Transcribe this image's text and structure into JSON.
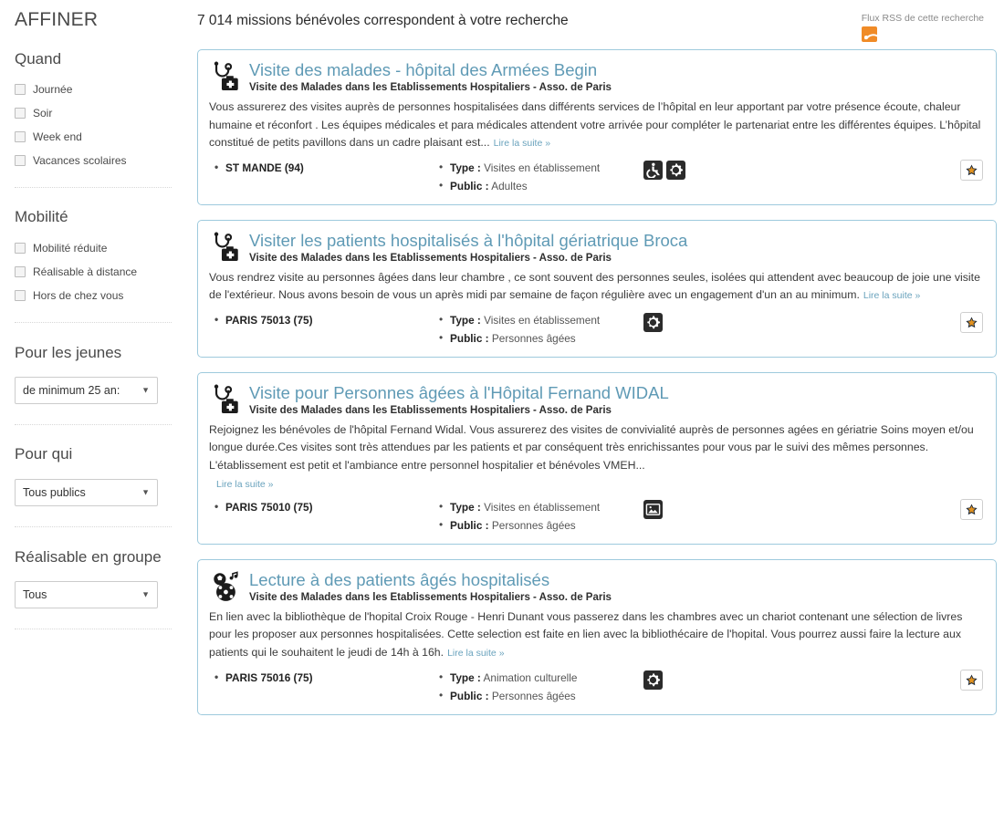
{
  "sidebar": {
    "title": "AFFINER",
    "facets": [
      {
        "heading": "Quand",
        "type": "checkboxes",
        "options": [
          "Journée",
          "Soir",
          "Week end",
          "Vacances scolaires"
        ]
      },
      {
        "heading": "Mobilité",
        "type": "checkboxes",
        "options": [
          "Mobilité réduite",
          "Réalisable à distance",
          "Hors de chez vous"
        ]
      },
      {
        "heading": "Pour les jeunes",
        "type": "select",
        "value": "de minimum 25 an:"
      },
      {
        "heading": "Pour qui",
        "type": "select",
        "value": "Tous publics"
      },
      {
        "heading": "Réalisable en groupe",
        "type": "select",
        "value": "Tous"
      }
    ]
  },
  "main": {
    "result_count_text": "7 014 missions bénévoles correspondent à votre recherche",
    "rss_label": "Flux RSS de cette recherche",
    "rss_icon": "rss-icon",
    "read_more_label": "Lire la suite »",
    "type_label": "Type :",
    "public_label": "Public :",
    "favorite_icon": "star-icon",
    "results": [
      {
        "icon": "stethoscope-medical-bag-icon",
        "title": "Visite des malades - hôpital des Armées Begin",
        "org": "Visite des Malades dans les Etablissements Hospitaliers - Asso. de Paris",
        "description": "Vous assurerez des visites auprès de personnes hospitalisées dans différents services de l’hôpital en leur apportant par votre présence écoute, chaleur humaine et réconfort . Les équipes médicales et para médicales attendent votre arrivée pour compléter le partenariat entre les différentes équipes. L’hôpital constitué de petits pavillons dans un cadre plaisant est...",
        "read_more_inline": true,
        "location": "ST MANDE (94)",
        "type_value": "Visites en établissement",
        "public_value": "Adultes",
        "badges": [
          "wheelchair-icon",
          "gear-icon"
        ]
      },
      {
        "icon": "stethoscope-medical-bag-icon",
        "title": "Visiter les patients hospitalisés à l'hôpital gériatrique Broca",
        "org": "Visite des Malades dans les Etablissements Hospitaliers - Asso. de Paris",
        "description": "Vous rendrez visite au personnes âgées dans leur chambre , ce sont souvent des personnes seules, isolées qui attendent avec beaucoup de joie une visite de l'extérieur. Nous avons besoin de vous un après midi par semaine de façon régulière avec un engagement d'un an au minimum.",
        "read_more_inline": true,
        "location": "PARIS 75013 (75)",
        "type_value": "Visites en établissement",
        "public_value": "Personnes âgées",
        "badges": [
          "gear-icon"
        ]
      },
      {
        "icon": "stethoscope-medical-bag-icon",
        "title": "Visite pour Personnes âgées à l'Hôpital Fernand WIDAL",
        "org": "Visite des Malades dans les Etablissements Hospitaliers - Asso. de Paris",
        "description": "Rejoignez les bénévoles de l'hôpital Fernand Widal. Vous assurerez des visites de convivialité auprès de personnes agées en gériatrie Soins moyen et/ou longue durée.Ces visites sont très attendues par les patients et par conséquent très enrichissantes pour vous par le suivi des mêmes personnes. L'établissement est petit et l'ambiance entre personnel hospitalier et bénévoles VMEH...",
        "read_more_inline": false,
        "location": "PARIS 75010 (75)",
        "type_value": "Visites en établissement",
        "public_value": "Personnes âgées",
        "badges": [
          "picture-icon"
        ]
      },
      {
        "icon": "culture-leisure-icon",
        "title": "Lecture à des patients âgés hospitalisés",
        "org": "Visite des Malades dans les Etablissements Hospitaliers - Asso. de Paris",
        "description": "En lien avec la bibliothèque de l'hopital Croix Rouge - Henri Dunant vous passerez dans les chambres avec un chariot contenant une sélection de livres pour les proposer aux personnes hospitalisées. Cette selection est faite en lien avec la bibliothécaire de l'hopital. Vous pourrez aussi faire la lecture aux patients qui le souhaitent le jeudi de 14h à 16h.",
        "read_more_inline": true,
        "location": "PARIS 75016 (75)",
        "type_value": "Animation culturelle",
        "public_value": "Personnes âgées",
        "badges": [
          "gear-icon"
        ]
      }
    ]
  },
  "colors": {
    "card_border": "#9ecadd",
    "title_blue": "#5f9ab5",
    "rss_orange": "#f08b27",
    "badge_dark": "#2b2b2b"
  }
}
